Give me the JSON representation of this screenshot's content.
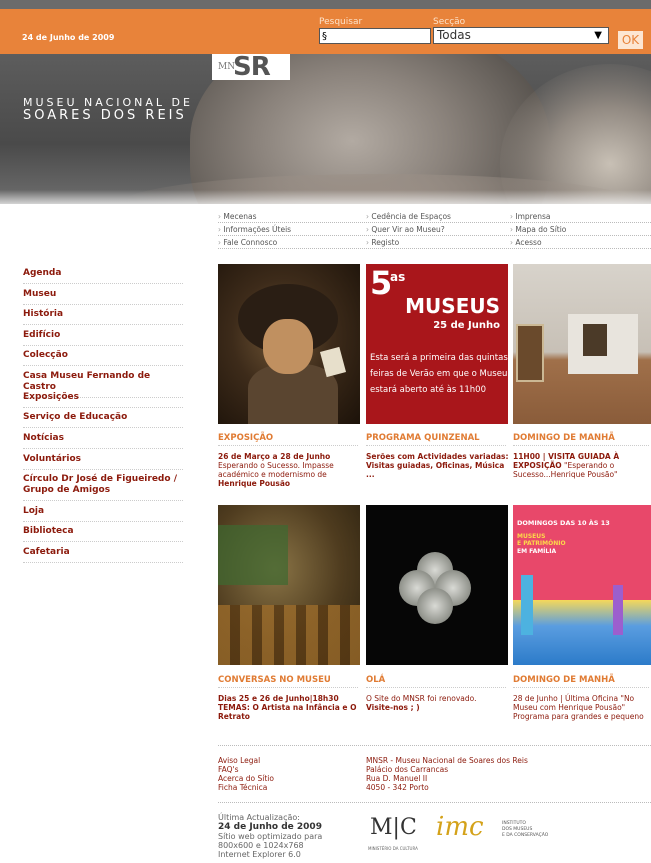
{
  "header": {
    "date": "24 de Junho de 2009",
    "search_label": "Pesquisar",
    "search_value": "§",
    "section_label": "Secção",
    "section_value": "Todas",
    "ok_label": "OK"
  },
  "banner": {
    "logo_mn": "MN",
    "logo_sr": "SR",
    "title_line1": "MUSEU NACIONAL DE",
    "title_line2": "SOARES DOS REIS"
  },
  "top_links": {
    "row1": [
      "Mecenas",
      "Cedência de Espaços",
      "Imprensa"
    ],
    "row2": [
      "Informações Úteis",
      "Quer Vir ao Museu?",
      "Mapa do Sítio"
    ],
    "row3": [
      "Fale Connosco",
      "Registo",
      "Acesso"
    ]
  },
  "sidebar": {
    "items": [
      "Agenda",
      "Museu",
      "História",
      "Edifício",
      "Colecção",
      "Casa Museu Fernando de Castro",
      "Exposições",
      "Serviço de Educação",
      "Notícias",
      "Voluntários",
      "Círculo Dr José de Figueiredo / Grupo de Amigos",
      "Loja",
      "Biblioteca",
      "Cafetaria"
    ]
  },
  "promo": {
    "big5": "5",
    "as": "as",
    "museus": "MUSEUS",
    "date": "25 de Junho",
    "text": "Esta será a primeira das quintas feiras de Verão em que o Museu estará aberto até às 11h00"
  },
  "poster": {
    "head": "DOMINGOS DAS 10 ÀS 13",
    "sub1a": "MUSEUS",
    "sub1b": "E PATRIMÓNIO",
    "sub2": "EM FAMÍLIA"
  },
  "cards": [
    {
      "title": "EXPOSIÇÃO",
      "line1": "26 de Março a 28 de Junho",
      "line2": "Esperando o Sucesso. Impasse académico e modernismo de",
      "line3": "Henrique Pousão"
    },
    {
      "title": "PROGRAMA QUINZENAL",
      "line1": "Serões com Actividades variadas: Visitas guiadas, Oficinas, Música ..."
    },
    {
      "title": "DOMINGO DE MANHÃ",
      "line1": "11H00 | VISITA GUIADA À EXPOSIÇÃO",
      "line2": "\"Esperando o Sucesso...Henrique Pousão\""
    },
    {
      "title": "CONVERSAS NO MUSEU",
      "line1": "Dias  25 e 26 de Junho|18h30 TEMAS: O Artista na Infância e O Retrato"
    },
    {
      "title": "OLÁ",
      "line1": "O Site do MNSR foi renovado.",
      "line2": "Visite-nos ; )"
    },
    {
      "title": "DOMINGO DE MANHÃ",
      "line1": "28 de Junho | Última Oficina \"No Museu com Henrique Pousão\" Programa para grandes e pequeno"
    }
  ],
  "footer": {
    "links": [
      "Aviso Legal",
      "FAQ's",
      "Acerca do Sítio",
      "Ficha Técnica"
    ],
    "address": [
      "MNSR - Museu Nacional de Soares dos Reis",
      "Palácio dos Carrancas",
      "Rua D. Manuel II",
      "4050 - 342 Porto"
    ],
    "update_label": "Última Actualização:",
    "update_date": "24 de Junho de 2009",
    "opt1": "Sítio web optimizado para",
    "opt2": "800x600 e 1024x768",
    "opt3": "Internet Explorer 6.0",
    "mc_logo": "M|C",
    "mc_sub": "MINISTÉRIO DA CULTURA",
    "imc_logo": "imc",
    "imc_text1": "INSTITUTO",
    "imc_text2": "DOS MUSEUS",
    "imc_text3": "E DA CONSERVAÇÃO"
  },
  "colors": {
    "orange": "#e8833a",
    "dark_red": "#8c1a0c",
    "promo_red": "#a9161b"
  }
}
